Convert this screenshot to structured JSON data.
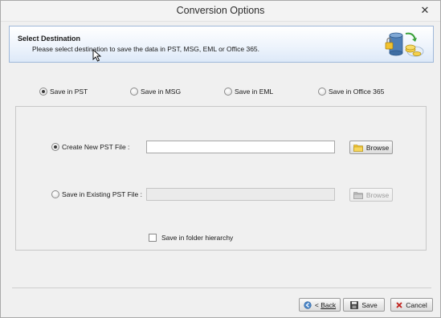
{
  "window": {
    "title": "Conversion Options",
    "close_glyph": "✕"
  },
  "header": {
    "title": "Select Destination",
    "description": "Please select destination to save the data in PST, MSG, EML or Office 365.",
    "icon": "storage-sync-icon"
  },
  "save_options": [
    {
      "label": "Save in PST",
      "checked": true
    },
    {
      "label": "Save in MSG",
      "checked": false
    },
    {
      "label": "Save in EML",
      "checked": false
    },
    {
      "label": "Save in Office 365",
      "checked": false
    }
  ],
  "pst_panel": {
    "create_new": {
      "label": "Create New PST File :",
      "checked": true,
      "value": "",
      "browse_label": "Browse"
    },
    "save_existing": {
      "label": "Save in Existing PST File :",
      "checked": false,
      "value": "",
      "browse_label": "Browse"
    },
    "folder_hierarchy": {
      "label": "Save in folder hierarchy",
      "checked": false
    }
  },
  "footer": {
    "back_prefix": "< ",
    "back_label": "Back",
    "save_label": "Save",
    "cancel_label": "Cancel"
  },
  "colors": {
    "header_border": "#9fb8d9",
    "header_gradient_end": "#dde9f8",
    "cancel_x": "#c0201b",
    "folder_icon": "#f2c230"
  }
}
